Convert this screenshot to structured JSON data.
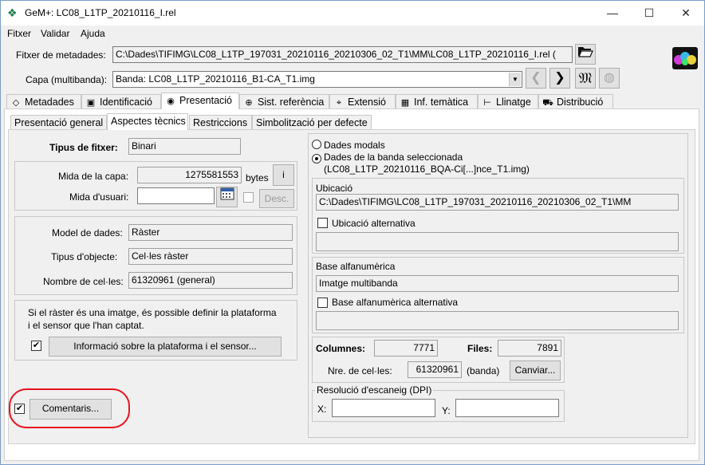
{
  "window": {
    "title": "GeM+: LC08_L1TP_20210116_I.rel",
    "minimize": "—",
    "maximize": "☐",
    "close": "✕"
  },
  "menu": [
    "Fitxer",
    "Validar",
    "Ajuda"
  ],
  "metadata_file": {
    "label": "Fitxer de metadades:",
    "value": "C:\\Dades\\TIFIMG\\LC08_L1TP_197031_20210116_20210306_02_T1\\MM\\LC08_L1TP_20210116_I.rel ("
  },
  "layer": {
    "label": "Capa (multibanda):",
    "value": "Banda: LC08_L1TP_20210116_B1-CA_T1.img"
  },
  "main_tabs": [
    {
      "label": "Metadades",
      "icon": "tag-icon"
    },
    {
      "label": "Identificació",
      "icon": "id-card-icon"
    },
    {
      "label": "Presentació",
      "icon": "eye-icon"
    },
    {
      "label": "Sist. referència",
      "icon": "globe-icon"
    },
    {
      "label": "Extensió",
      "icon": "map-icon"
    },
    {
      "label": "Inf. temàtica",
      "icon": "table-icon"
    },
    {
      "label": "Llinatge",
      "icon": "tree-icon"
    },
    {
      "label": "Distribució",
      "icon": "truck-icon"
    }
  ],
  "sub_tabs": [
    "Presentació general",
    "Aspectes tècnics",
    "Restriccions",
    "Simbolització per defecte"
  ],
  "left": {
    "file_type_label": "Tipus de fitxer:",
    "file_type_value": "Binari",
    "layer_size_label": "Mida de la capa:",
    "layer_size_value": "1275581553",
    "layer_size_unit": "bytes",
    "info_button": "i",
    "user_size_label": "Mida d'usuari:",
    "user_size_value": "",
    "desc_button": "Desc.",
    "data_model_label": "Model de dades:",
    "data_model_value": "Ràster",
    "object_type_label": "Tipus d'objecte:",
    "object_type_value": "Cel·les ràster",
    "cell_count_label": "Nombre de cel·les:",
    "cell_count_value": "61320961 (general)",
    "platform_text_1": "Si el ràster és una imatge, és possible definir la plataforma",
    "platform_text_2": "i el sensor que l'han captat.",
    "platform_button": "Informació sobre la plataforma i el sensor...",
    "comments_button": "Comentaris..."
  },
  "right": {
    "radio_modal": "Dades modals",
    "radio_band_1": "Dades de la banda seleccionada",
    "radio_band_2": "(LC08_L1TP_20210116_BQA-Ci[...]nce_T1.img)",
    "location_title": "Ubicació",
    "location_value": "C:\\Dades\\TIFIMG\\LC08_L1TP_197031_20210116_20210306_02_T1\\MM",
    "alt_location_label": "Ubicació alternativa",
    "alt_location_value": "",
    "alphanum_title": "Base alfanumèrica",
    "alphanum_value": "Imatge multibanda",
    "alt_alphanum_label": "Base alfanumèrica alternativa",
    "alt_alphanum_value": "",
    "columns_label": "Columnes:",
    "columns_value": "7771",
    "rows_label": "Files:",
    "rows_value": "7891",
    "cells_label": "Nre. de cel·les:",
    "cells_value": "61320961",
    "cells_unit": "(banda)",
    "change_button": "Canviar...",
    "dpi_title": "Resolució d'escaneig (DPI)",
    "x_label": "X:",
    "x_value": "",
    "y_label": "Y:",
    "y_value": ""
  },
  "colors": {
    "annotation": "#e8121e",
    "title_icon": "#1e7a4d"
  }
}
